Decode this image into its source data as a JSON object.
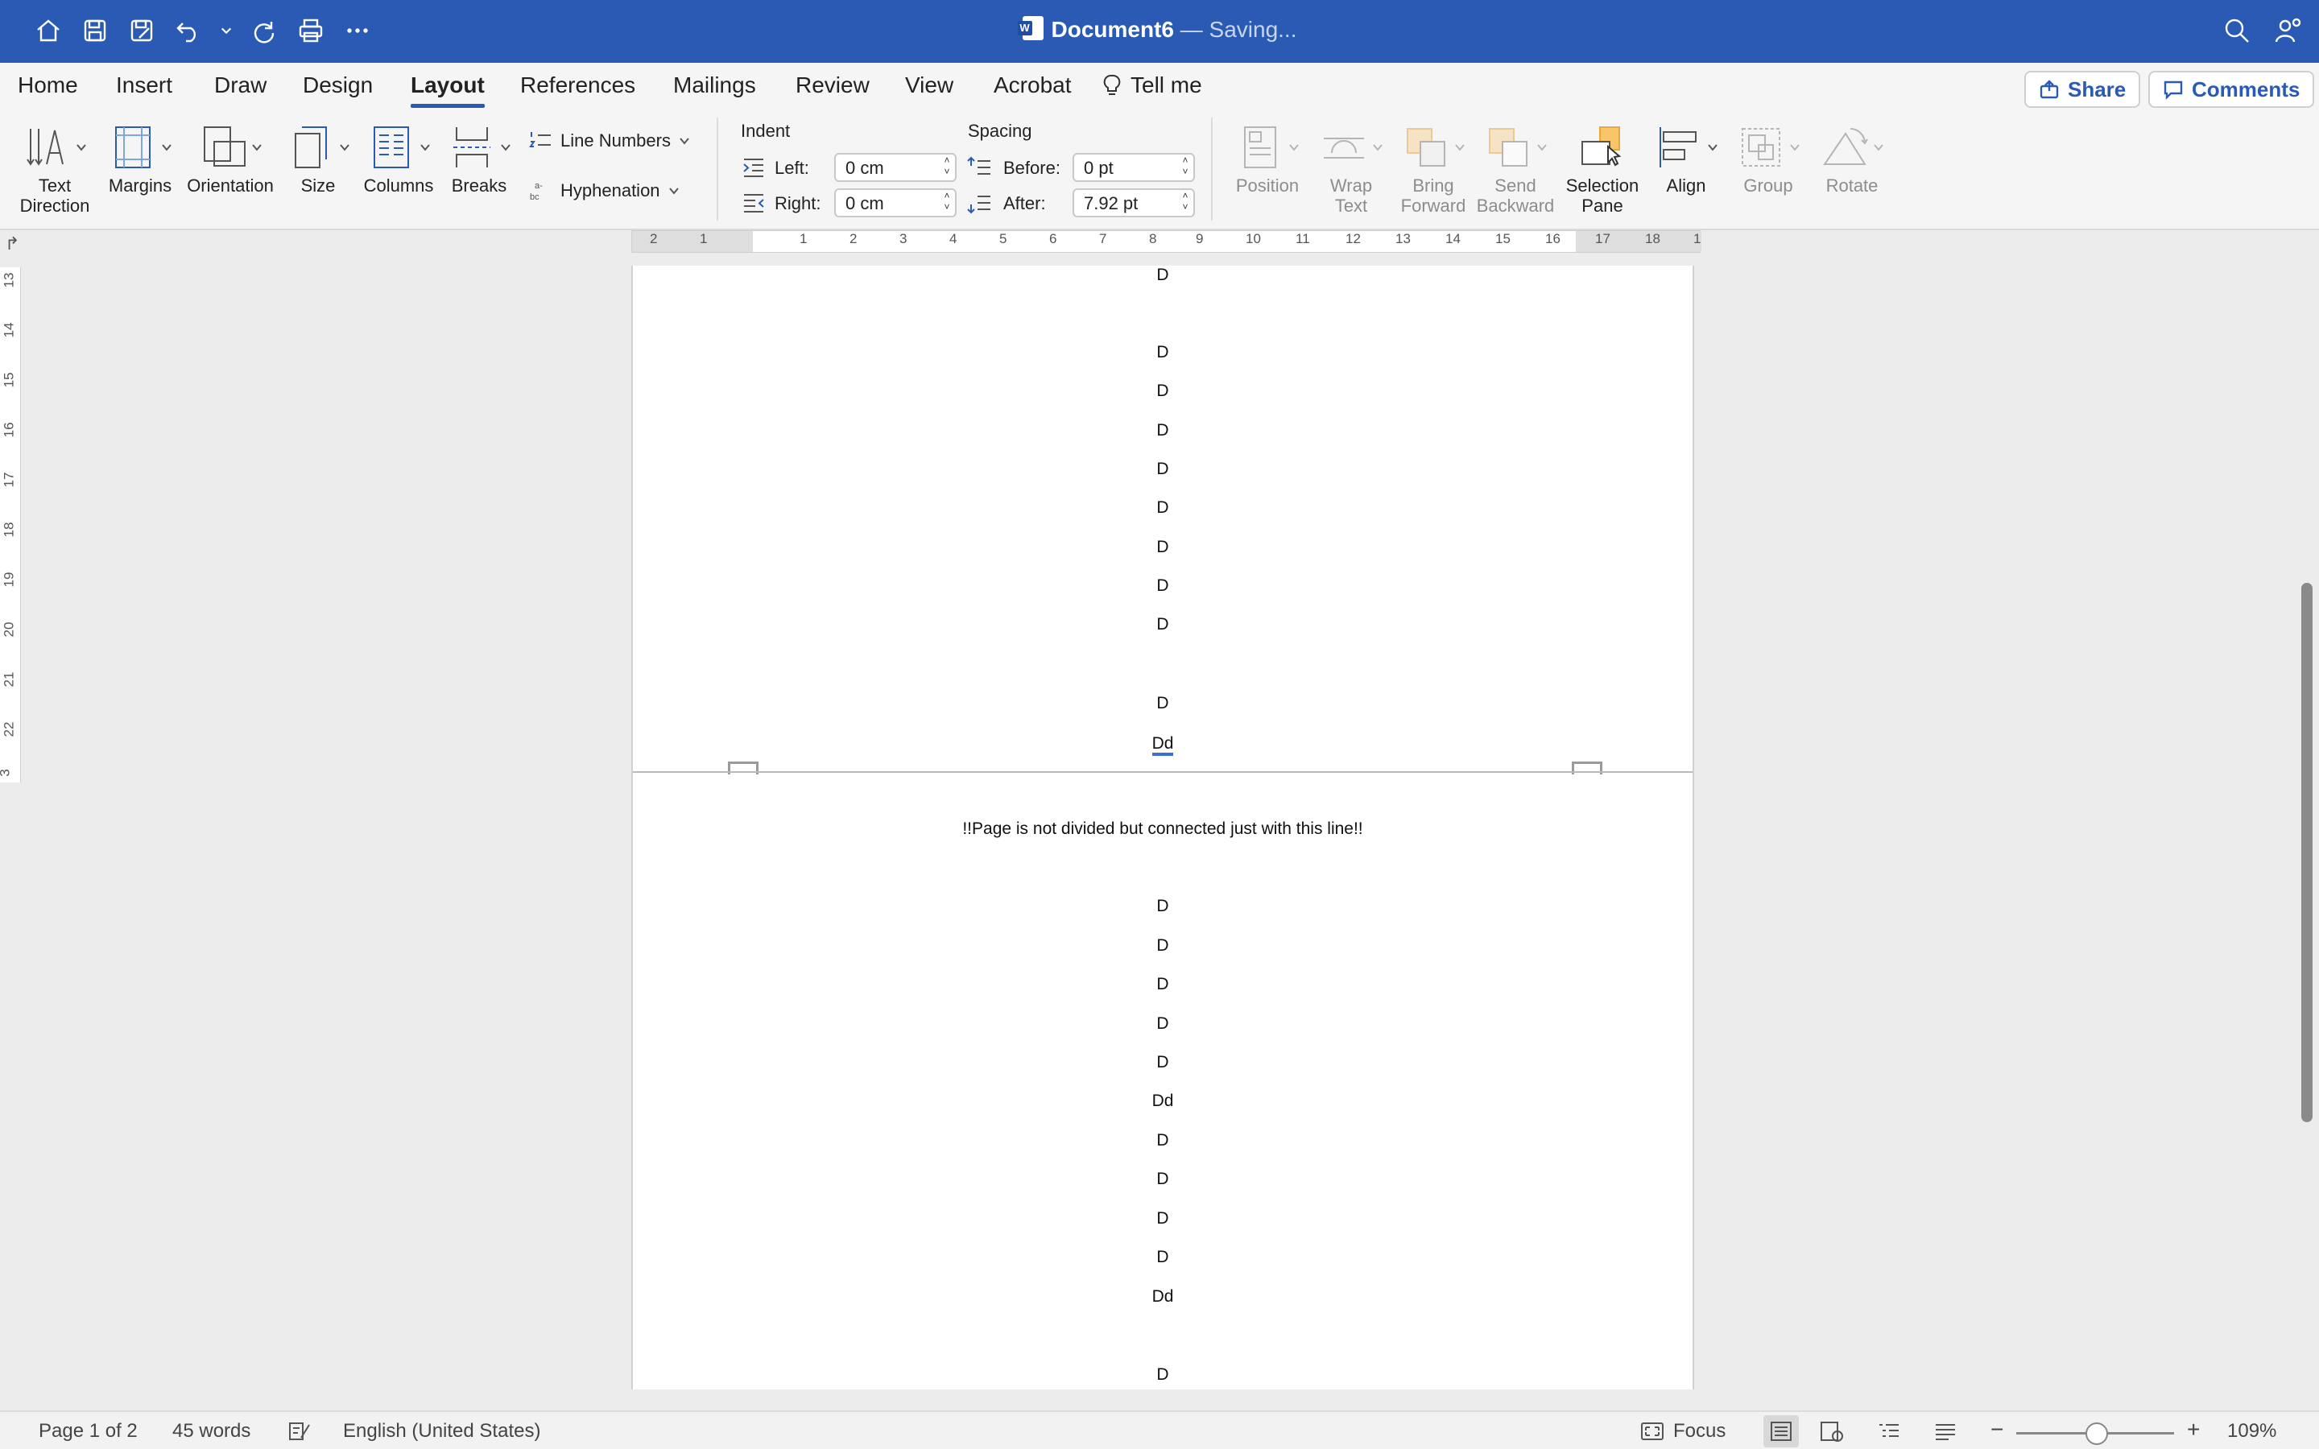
{
  "titlebar": {
    "doc_name": "Document6",
    "status": " — Saving..."
  },
  "tabs": [
    {
      "label": "Home"
    },
    {
      "label": "Insert"
    },
    {
      "label": "Draw"
    },
    {
      "label": "Design"
    },
    {
      "label": "Layout"
    },
    {
      "label": "References"
    },
    {
      "label": "Mailings"
    },
    {
      "label": "Review"
    },
    {
      "label": "View"
    },
    {
      "label": "Acrobat"
    },
    {
      "label": "Tell me"
    }
  ],
  "share_label": "Share",
  "comments_label": "Comments",
  "ribbon": {
    "text_direction": [
      "Text",
      "Direction"
    ],
    "margins": "Margins",
    "orientation": "Orientation",
    "size": "Size",
    "columns": "Columns",
    "breaks": "Breaks",
    "line_numbers": "Line Numbers",
    "hyphenation": "Hyphenation",
    "indent_label": "Indent",
    "indent_left_label": "Left:",
    "indent_left_value": "0 cm",
    "indent_right_label": "Right:",
    "indent_right_value": "0 cm",
    "spacing_label": "Spacing",
    "spacing_before_label": "Before:",
    "spacing_before_value": "0 pt",
    "spacing_after_label": "After:",
    "spacing_after_value": "7.92 pt",
    "position": "Position",
    "wrap_text": [
      "Wrap",
      "Text"
    ],
    "bring_forward": [
      "Bring",
      "Forward"
    ],
    "send_backward": [
      "Send",
      "Backward"
    ],
    "selection_pane": [
      "Selection",
      "Pane"
    ],
    "align": "Align",
    "group": "Group",
    "rotate": "Rotate"
  },
  "ruler": {
    "h_numbers": [
      "2",
      "1",
      "1",
      "2",
      "3",
      "4",
      "5",
      "6",
      "7",
      "8",
      "9",
      "10",
      "11",
      "12",
      "13",
      "14",
      "15",
      "16",
      "17",
      "18",
      "1"
    ],
    "v_numbers": [
      "13",
      "14",
      "15",
      "16",
      "17",
      "18",
      "19",
      "20",
      "21",
      "22",
      "3"
    ]
  },
  "document": {
    "page1_lines": [
      "D",
      "D",
      "D",
      "D",
      "D",
      "D",
      "D",
      "D",
      "D",
      "D",
      "Dd"
    ],
    "note": "!!Page is not divided but connected just with this line!!",
    "page2_lines": [
      "D",
      "D",
      "D",
      "D",
      "D",
      "Dd",
      "D",
      "D",
      "D",
      "D",
      "Dd",
      "D"
    ]
  },
  "statusbar": {
    "page": "Page 1 of 2",
    "words": "45 words",
    "language": "English (United States)",
    "focus": "Focus",
    "zoom_minus": "−",
    "zoom_plus": "+",
    "zoom": "109%"
  }
}
